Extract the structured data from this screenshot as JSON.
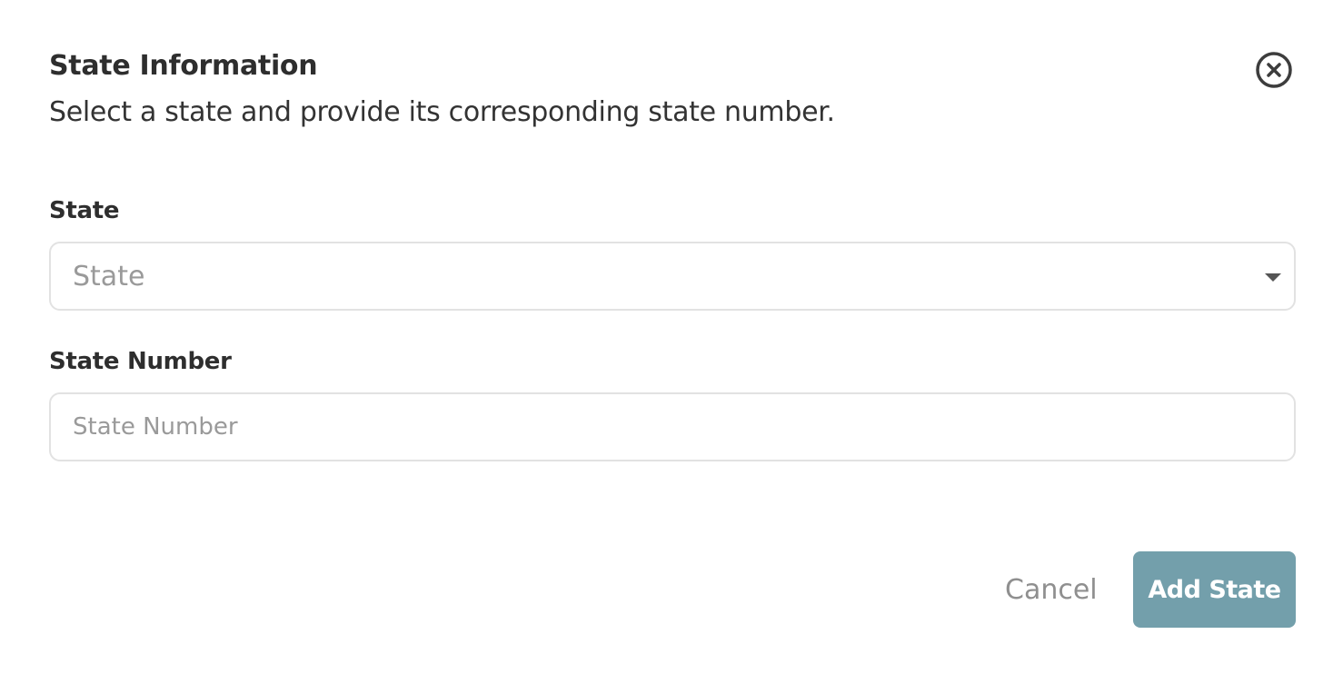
{
  "dialog": {
    "title": "State Information",
    "subtitle": "Select a state and provide its corresponding state number.",
    "close_icon": "close-circle-icon"
  },
  "fields": {
    "state": {
      "label": "State",
      "placeholder": "State",
      "selected_value": "",
      "dropdown_icon": "caret-down-icon"
    },
    "state_number": {
      "label": "State Number",
      "placeholder": "State Number",
      "value": ""
    }
  },
  "actions": {
    "cancel_label": "Cancel",
    "submit_label": "Add State"
  },
  "colors": {
    "primary_button": "#739fab",
    "border": "#e2e2e2",
    "placeholder": "#9a9a9a"
  }
}
